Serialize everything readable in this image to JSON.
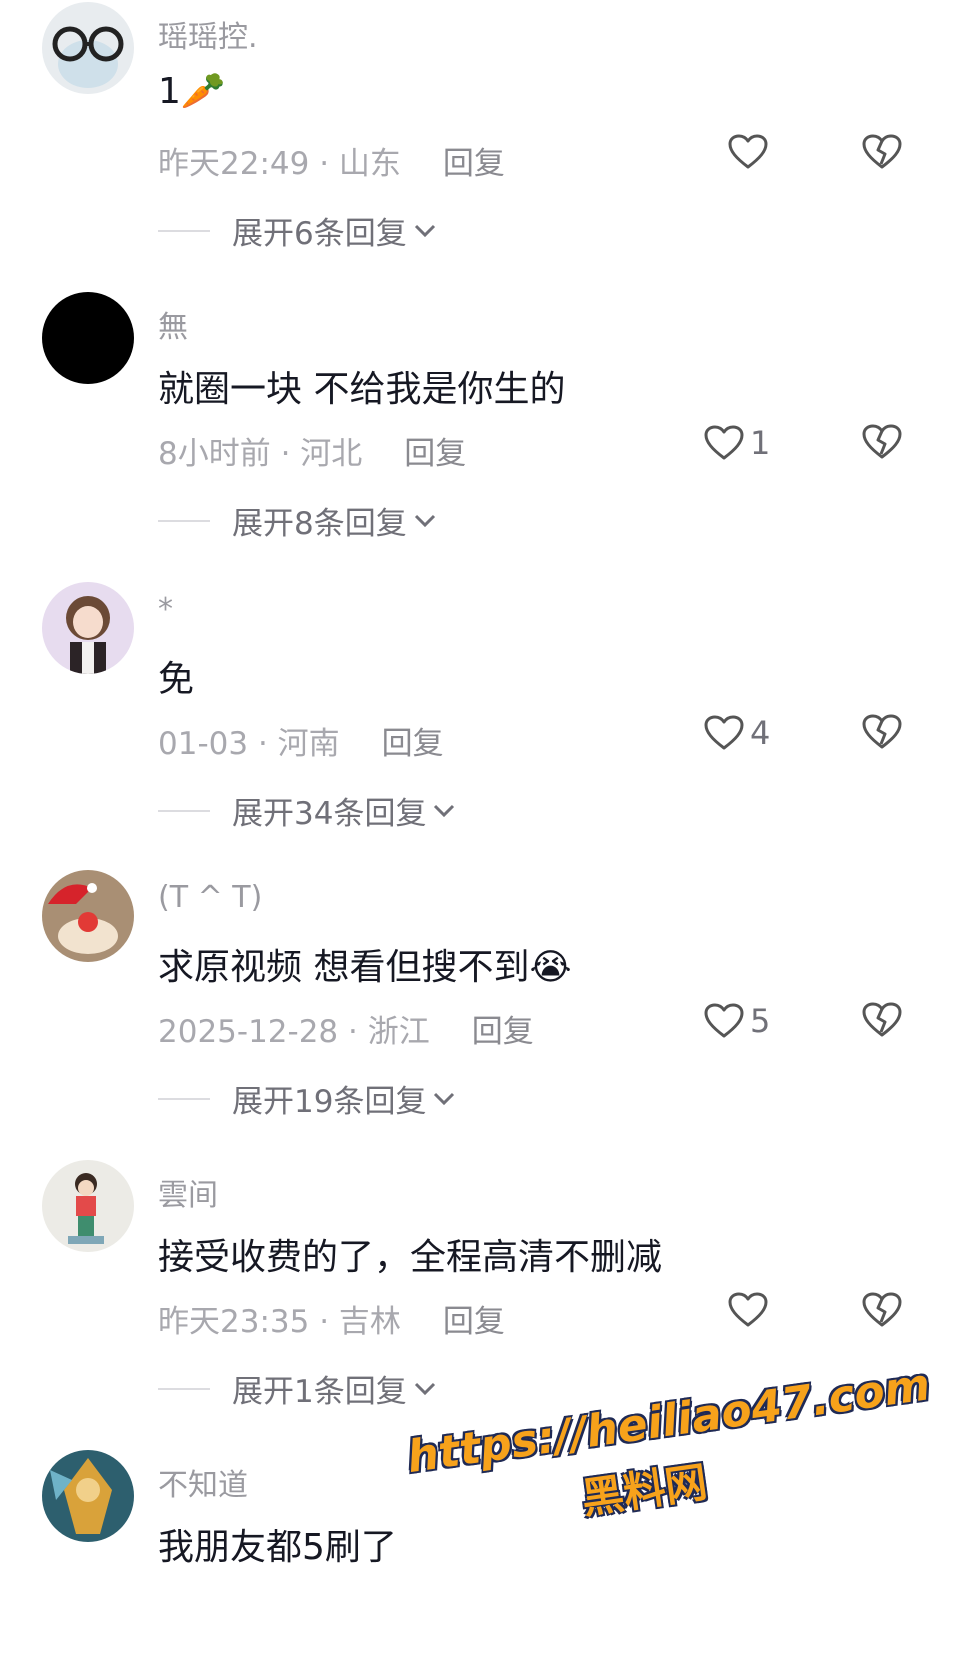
{
  "comments": [
    {
      "username": "瑶瑶控.",
      "content": "1🥕",
      "time": "昨天22:49",
      "location": "山东",
      "reply": "回复",
      "likes": "",
      "expand": "展开6条回复"
    },
    {
      "username": "無",
      "content": "就圈一块 不给我是你生的",
      "time": "8小时前",
      "location": "河北",
      "reply": "回复",
      "likes": "1",
      "expand": "展开8条回复"
    },
    {
      "username": "*",
      "content": "免",
      "time": "01-03",
      "location": "河南",
      "reply": "回复",
      "likes": "4",
      "expand": "展开34条回复"
    },
    {
      "username": "(T ^ T)",
      "content": "求原视频 想看但搜不到😭",
      "time": "2025-12-28",
      "location": "浙江",
      "reply": "回复",
      "likes": "5",
      "expand": "展开19条回复"
    },
    {
      "username": "雲间",
      "content": "接受收费的了，全程高清不删减",
      "time": "昨天23:35",
      "location": "吉林",
      "reply": "回复",
      "likes": "",
      "expand": "展开1条回复"
    },
    {
      "username": "不知道",
      "content": "我朋友都5刷了"
    }
  ],
  "separator": " · ",
  "watermark": {
    "url": "https://heiliao47.com",
    "name": "黑料网"
  },
  "colors": {
    "accent": "#f7a21b",
    "text": "#161823",
    "muted": "#a8a8ae"
  }
}
